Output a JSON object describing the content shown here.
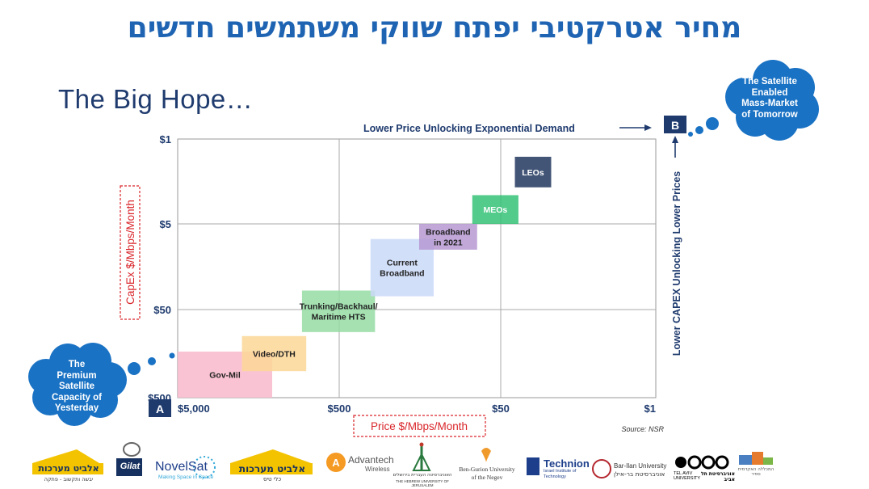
{
  "slide": {
    "hebrew_title": "מחיר אטרקטיבי יפתח שווקי משתמשים חדשים",
    "subtitle": "The Big Hope…",
    "source": "Source: NSR"
  },
  "annotations": {
    "top_arrow_label": "Lower Price Unlocking Exponential Demand",
    "right_arrow_label": "Lower CAPEX Unlocking Lower Prices",
    "point_a": "A",
    "point_b": "B",
    "bubble_top_lines": [
      "The Satellite",
      "Enabled",
      "Mass-Market",
      "of Tomorrow"
    ],
    "bubble_bottom_lines": [
      "The",
      "Premium",
      "Satellite",
      "Capacity of",
      "Yesterday"
    ]
  },
  "chart_data": {
    "type": "area",
    "title": "The Big Hope…",
    "xlabel": "Price $/Mbps/Month",
    "ylabel": "CapEx $/Mbps/Month",
    "x_ticks": [
      "$5,000",
      "$500",
      "$50",
      "$1"
    ],
    "y_ticks": [
      "$1",
      "$5",
      "$50",
      "$500"
    ],
    "x_scale": "log-reversed",
    "y_scale": "log-reversed",
    "grid": true,
    "segments": [
      {
        "name": "Gov-Mil",
        "color": "#f9b8cb",
        "price_range": [
          5000,
          1300
        ],
        "capex_range": [
          500,
          150
        ]
      },
      {
        "name": "Video/DTH",
        "color": "#fbd797",
        "price_range": [
          2000,
          800
        ],
        "capex_range": [
          250,
          100
        ]
      },
      {
        "name": "Trunking/Backhaul/\nMaritime HTS",
        "color": "#95dca3",
        "price_range": [
          850,
          300
        ],
        "capex_range": [
          90,
          30
        ]
      },
      {
        "name": "Current\nBroadband",
        "color": "#cad9f8",
        "price_range": [
          320,
          130
        ],
        "capex_range": [
          35,
          7.5
        ]
      },
      {
        "name": "Broadband\nin 2021",
        "color": "#b699d2",
        "price_range": [
          160,
          70
        ],
        "capex_range": [
          10,
          5
        ]
      },
      {
        "name": "MEOs",
        "color": "#34c277",
        "price_range": [
          75,
          32
        ],
        "capex_range": [
          5,
          2.9
        ]
      },
      {
        "name": "LEOs",
        "color": "#21375e",
        "price_range": [
          35,
          14
        ],
        "capex_range": [
          2.5,
          1.4
        ]
      }
    ]
  },
  "logos": [
    {
      "name": "elbit-systems-land",
      "text": "אלביט מערכות",
      "subtext": "יבשה ותקשוב - פתקה"
    },
    {
      "name": "gilat",
      "text": "Gilat"
    },
    {
      "name": "novelsat",
      "text": "NovelSat",
      "subtext": "Making Space in Space"
    },
    {
      "name": "elbit-systems-air",
      "text": "אלביט מערכות",
      "subtext": "כלי טיס"
    },
    {
      "name": "advantech",
      "text": "Advantech",
      "subtext": "Wireless"
    },
    {
      "name": "hebrew-university",
      "text": "האוניברסיטה העברית בירושלים",
      "subtext": "THE HEBREW UNIVERSITY OF JERUSALEM"
    },
    {
      "name": "ben-gurion",
      "text": "Ben-Gurion University",
      "subtext": "of the Negev"
    },
    {
      "name": "technion",
      "text": "Technion",
      "subtext": "Israel Institute of Technology"
    },
    {
      "name": "bar-ilan",
      "text": "Bar-Ilan University",
      "subtext": "אוניברסיטת בר-אילן"
    },
    {
      "name": "tel-aviv",
      "text": "TEL AVIV UNIVERSITY",
      "subtext": "אוניברסיטת תל אביב"
    },
    {
      "name": "academic-college",
      "text": "המכללה האקדמית ספיר"
    }
  ],
  "colors": {
    "title_blue": "#1f64b3",
    "navy": "#1f3b6e",
    "red_label": "#d9252a",
    "bubble_blue": "#1a72c4"
  }
}
